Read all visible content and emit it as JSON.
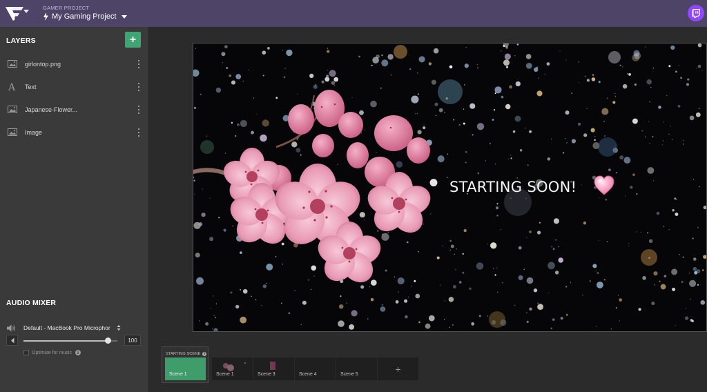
{
  "app": {
    "project_caption": "GAMER PROJECT",
    "project_name": "My Gaming Project",
    "brand_color": "#4d4468",
    "twitch_color": "#9146ff",
    "accent_green": "#3ea672"
  },
  "layers": {
    "title": "LAYERS",
    "add_label": "+",
    "items": [
      {
        "label": "girlontop.png",
        "icon": "image-icon"
      },
      {
        "label": "Text",
        "icon": "text-icon"
      },
      {
        "label": "Japanese-Flower...",
        "icon": "image-icon"
      },
      {
        "label": "Image",
        "icon": "image-icon"
      }
    ]
  },
  "audio": {
    "title": "AUDIO MIXER",
    "device": "Default - MacBook Pro Microphor",
    "volume": "100",
    "volume_fraction": 0.9,
    "optimize_label": "Optimize for music",
    "optimize_checked": false
  },
  "canvas": {
    "overlay_text": "STARTING SOON!",
    "emoji": "pink-heart-icon"
  },
  "scenes": {
    "group_label": "STARTING SCENE",
    "items": [
      {
        "label": "Scene 1",
        "active": true
      },
      {
        "label": "Scene 1",
        "active": false
      },
      {
        "label": "Scene 3",
        "active": false
      },
      {
        "label": "Scene 4",
        "active": false
      },
      {
        "label": "Scene 5",
        "active": false
      }
    ],
    "add_label": "+"
  }
}
